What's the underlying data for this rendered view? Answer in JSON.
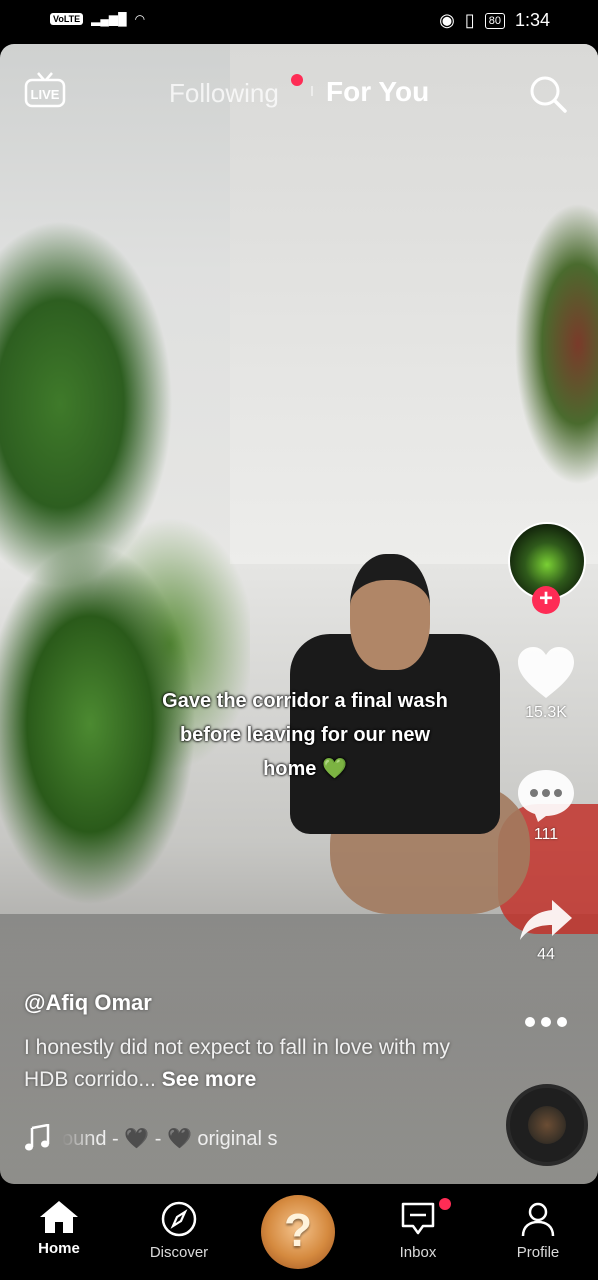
{
  "status_bar": {
    "volte": "VoLTE",
    "battery": "80",
    "time": "1:34"
  },
  "top_nav": {
    "live_label": "LIVE",
    "tabs": [
      {
        "label": "Following",
        "active": false,
        "has_dot": true
      },
      {
        "label": "For You",
        "active": true
      }
    ]
  },
  "video": {
    "caption": "Gave the corridor a final wash before leaving for our new home",
    "caption_emoji": "💚"
  },
  "sidebar": {
    "likes": "15.3K",
    "comments": "111",
    "shares": "44"
  },
  "post": {
    "username": "@Afiq Omar",
    "description": "I honestly did not expect to fall in love with my HDB corrido...",
    "see_more": "See more",
    "sound": "ound - 🖤 - 🖤    original s"
  },
  "bottom_nav": {
    "items": [
      {
        "label": "Home",
        "icon": "home-icon",
        "active": true
      },
      {
        "label": "Discover",
        "icon": "compass-icon",
        "active": false
      },
      {
        "label": "Inbox",
        "icon": "inbox-icon",
        "active": false,
        "has_dot": true
      },
      {
        "label": "Profile",
        "icon": "profile-icon",
        "active": false
      }
    ],
    "create_label": "?"
  },
  "colors": {
    "accent": "#fe2c55",
    "background": "#000000"
  }
}
